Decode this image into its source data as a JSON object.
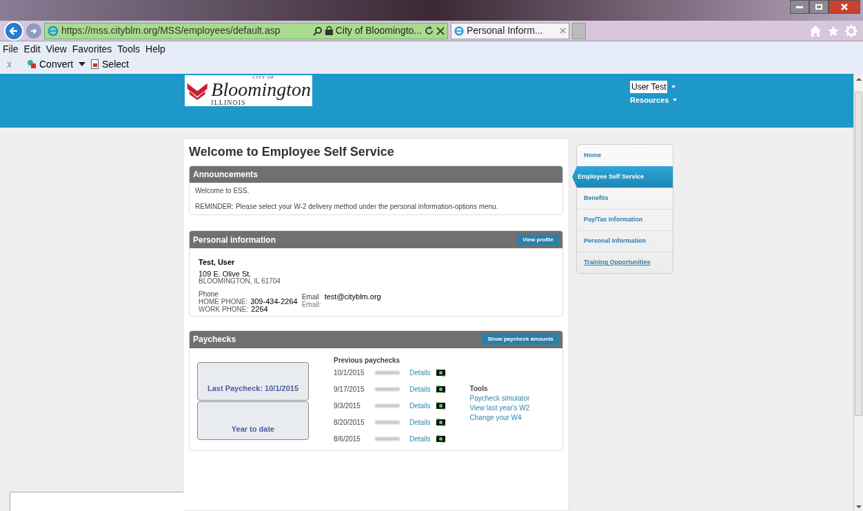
{
  "browser": {
    "address": "https://mss.cityblm.org/MSS/employees/default.asp",
    "address_tab": "City of Bloomingto...",
    "tabs": [
      {
        "label": "Personal Inform...",
        "selected": true
      }
    ],
    "menu": [
      "File",
      "Edit",
      "View",
      "Favorites",
      "Tools",
      "Help"
    ],
    "command_bar": {
      "close": "x",
      "items": [
        "Convert",
        "Select"
      ]
    }
  },
  "header": {
    "logo": {
      "top": "CITY OF",
      "name": "Bloomington",
      "state": "ILLINOIS"
    },
    "user": "User Test",
    "resources": "Resources"
  },
  "title": "Welcome to Employee Self Service",
  "announcements": {
    "title": "Announcements",
    "lines": [
      "Welcome to ESS.",
      "REMINDER: Please select your W-2 delivery method under the personal information-options menu."
    ]
  },
  "personal": {
    "title": "Personal information",
    "button": "View profile",
    "name": "Test, User",
    "street": "109 E. Olive St.",
    "city": "BLOOMINGTON, IL 61704",
    "phone_label": "Phone",
    "phones": [
      {
        "label": "HOME PHONE:",
        "value": "309-434-2264"
      },
      {
        "label": "WORK PHONE:",
        "value": "2264"
      }
    ],
    "email_label": "Email",
    "email_value": "test@cityblm.org",
    "email_sub": "Email:"
  },
  "paychecks": {
    "title": "Paychecks",
    "button": "Show paycheck amounts",
    "last": "Last Paycheck: 10/1/2015",
    "ytd": "Year to date",
    "previous_label": "Previous paychecks",
    "rows": [
      {
        "date": "10/1/2015",
        "link": "Details"
      },
      {
        "date": "9/17/2015",
        "link": "Details"
      },
      {
        "date": "9/3/2015",
        "link": "Details"
      },
      {
        "date": "8/20/2015",
        "link": "Details"
      },
      {
        "date": "8/6/2015",
        "link": "Details"
      }
    ],
    "tools_label": "Tools",
    "tools": [
      "Paycheck simulator",
      "View last year's W2",
      "Change your W4"
    ]
  },
  "sidebar": {
    "items": [
      {
        "label": "Home",
        "selected": false,
        "underlined": false
      },
      {
        "label": "Employee Self Service",
        "selected": true,
        "underlined": false
      },
      {
        "label": "Benefits",
        "selected": false,
        "underlined": false
      },
      {
        "label": "Pay/Tax Information",
        "selected": false,
        "underlined": false
      },
      {
        "label": "Personal Information",
        "selected": false,
        "underlined": false
      },
      {
        "label": "Training Opportunities",
        "selected": false,
        "underlined": true
      }
    ]
  }
}
